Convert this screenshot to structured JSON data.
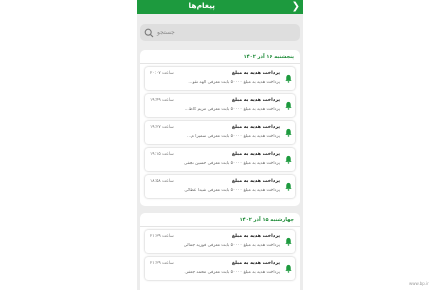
{
  "header": {
    "title": "پیغام‌ها",
    "back_icon": "chevron-right-icon"
  },
  "search": {
    "placeholder": "جستجو"
  },
  "groups": [
    {
      "date": "پنجشنبه ۱۶ آذر ۱۴۰۲",
      "items": [
        {
          "title": "پرداخت هدیه به مبلغ",
          "body": "پرداخت هدیه به مبلغ ۵۰۰۰۰ بابت معرفی الهه تقو...",
          "time": "ساعت ۲۰:۰۷"
        },
        {
          "title": "پرداخت هدیه به مبلغ",
          "body": "پرداخت هدیه به مبلغ ۵۰۰۰۰ بابت معرفی مریم کاظ...",
          "time": "ساعت ۱۹:۴۹"
        },
        {
          "title": "پرداخت هدیه به مبلغ",
          "body": "پرداخت هدیه به مبلغ ۵۰۰۰۰ بابت معرفی سمیرا م...",
          "time": "ساعت ۱۹:۲۷"
        },
        {
          "title": "پرداخت هدیه به مبلغ",
          "body": "پرداخت هدیه به مبلغ ۵۰۰۰۰ بابت معرفی حسین نجفی...",
          "time": "ساعت ۱۹:۱۵"
        },
        {
          "title": "پرداخت هدیه به مبلغ",
          "body": "پرداخت هدیه به مبلغ ۵۰۰۰۰ بابت معرفی شیدا عطائی...",
          "time": "ساعت ۱۸:۵۸"
        }
      ]
    },
    {
      "date": "چهارشنبه ۱۵ آذر ۱۴۰۲",
      "items": [
        {
          "title": "پرداخت هدیه به مبلغ",
          "body": "پرداخت هدیه به مبلغ ۵۰۰۰۰ بابت معرفی فوزیه جمالی...",
          "time": "ساعت ۲۱:۳۹"
        },
        {
          "title": "پرداخت هدیه به مبلغ",
          "body": "پرداخت هدیه به مبلغ ۵۰۰۰۰ بابت معرفی محمد جعفر...",
          "time": "ساعت ۲۱:۲۹"
        }
      ]
    }
  ],
  "watermark": "www.bp.ir",
  "colors": {
    "primary": "#1d9a3e",
    "date_text": "#1d8a37",
    "background": "#ececec"
  }
}
